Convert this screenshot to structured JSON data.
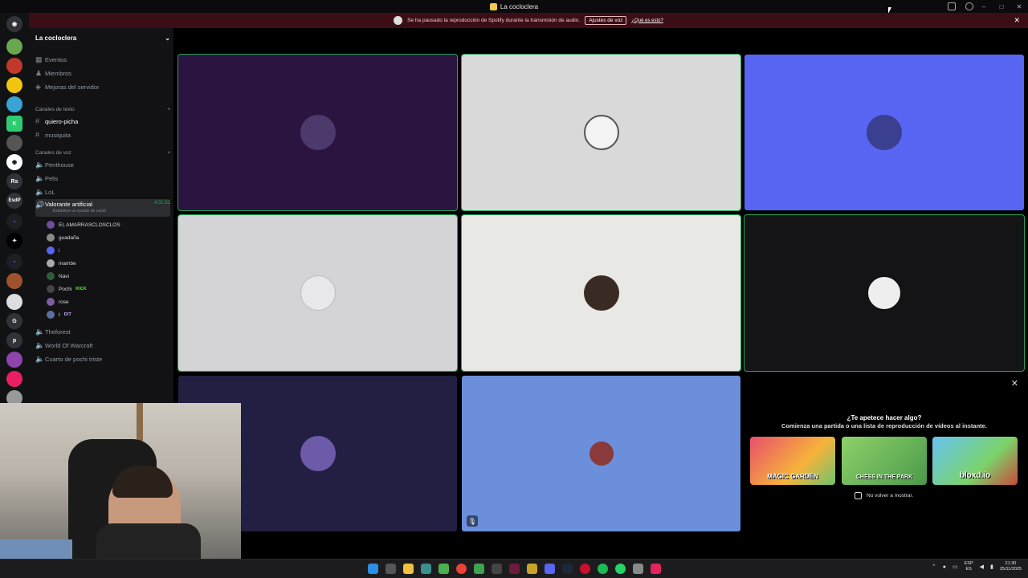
{
  "window": {
    "title": "La cocloclera"
  },
  "notice": {
    "text": "Se ha pausado la reproducción de Spotify durante la transmisión de audio.",
    "button": "Ajustes de voz",
    "link": "¿Qué es esto?"
  },
  "servers": [
    "Rs",
    "EsdP",
    "G",
    "p"
  ],
  "sidebar": {
    "guild_name": "La cocloclera",
    "top_items": [
      "Eventos",
      "Miembros",
      "Mejoras del servidor"
    ],
    "text_category": "Canales de texto",
    "text_channels": [
      "quiero-picha",
      "musiquita"
    ],
    "voice_category": "Canales de voz",
    "voice_channels_top": [
      "Penthouse",
      "Pelis",
      "LoL"
    ],
    "active_voice": {
      "name": "Valorante artificial",
      "status": "Establece un estado de canal",
      "time": "4:31:52"
    },
    "members": [
      "EL AMARRASCLOSCLOS",
      "guadaña",
      "i",
      "mambe",
      "Navi",
      "Pochi",
      "rose",
      "t"
    ],
    "member_tags": {
      "pochi": "KICK",
      "t": "D/T"
    },
    "voice_channels_bottom": [
      "Theforest",
      "World Of Warcraft",
      "Cuarto de pochi triste"
    ]
  },
  "activity": {
    "title": "¿Te apetece hacer algo?",
    "subtitle": "Comienza una partida o una lista de reproducción de vídeos al instante.",
    "games": [
      "MAGIC GARDEN",
      "CHESS IN THE PARK",
      "bloxd.io"
    ],
    "checkbox_label": "No volver a mostrar."
  },
  "tray": {
    "lang1": "ESP",
    "lang2": "ES",
    "time": "21:30",
    "date": "25/11/2025"
  },
  "colors": {
    "accent": "#5865f2",
    "speaking": "#23a55a",
    "notice_bg": "#3b0e15"
  }
}
